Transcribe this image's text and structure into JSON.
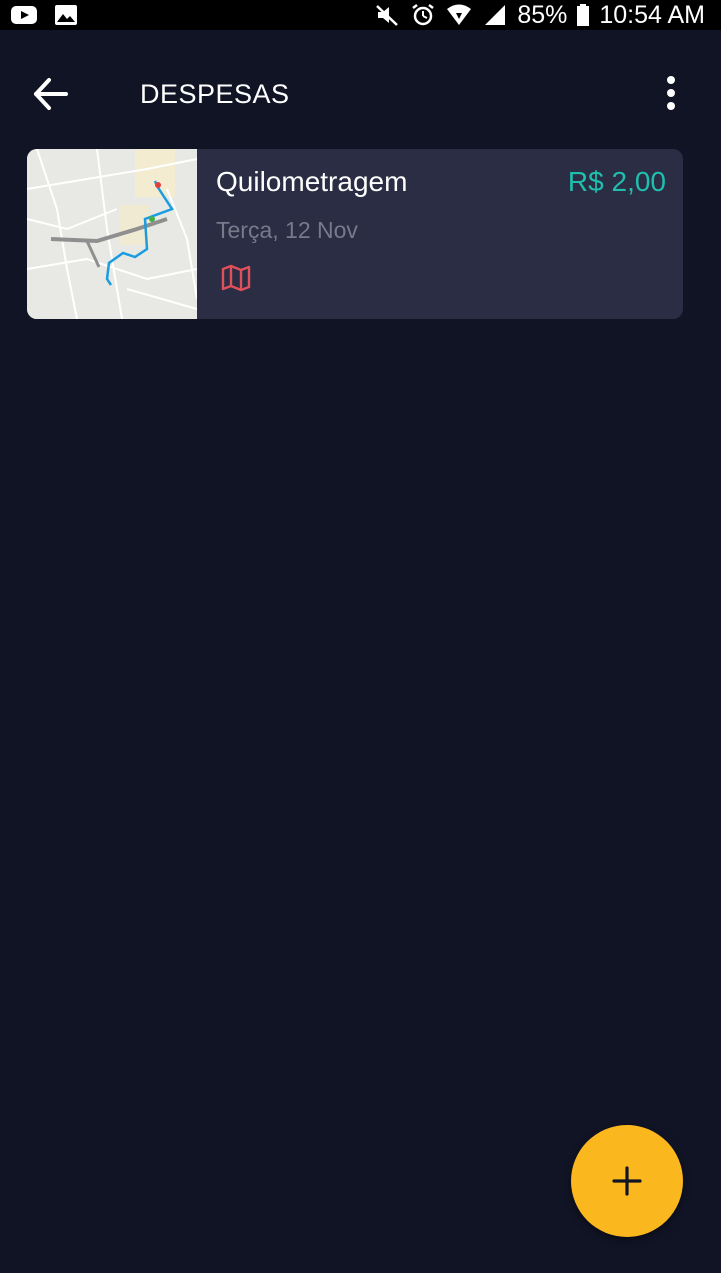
{
  "status_bar": {
    "icons_left": [
      "youtube-icon",
      "image-icon"
    ],
    "icons_right": [
      "mute-icon",
      "alarm-icon",
      "wifi-icon",
      "signal-icon"
    ],
    "battery_percent": "85%",
    "battery_icon": "battery-icon",
    "time": "10:54 AM"
  },
  "app_bar": {
    "back_icon": "arrow-back-icon",
    "title": "DESPESAS",
    "menu_icon": "more-vert-icon"
  },
  "expenses": [
    {
      "thumbnail": "route-map-thumbnail",
      "title": "Quilometragem",
      "amount": "R$ 2,00",
      "date": "Terça, 12 Nov",
      "type_icon": "map-icon"
    }
  ],
  "fab": {
    "icon": "plus-icon"
  },
  "colors": {
    "background": "#111425",
    "card": "#2a2d43",
    "amount": "#1fbfae",
    "date": "#777a8a",
    "map_icon": "#e0505a",
    "fab": "#fbb81e",
    "route": "#1a9de0"
  }
}
